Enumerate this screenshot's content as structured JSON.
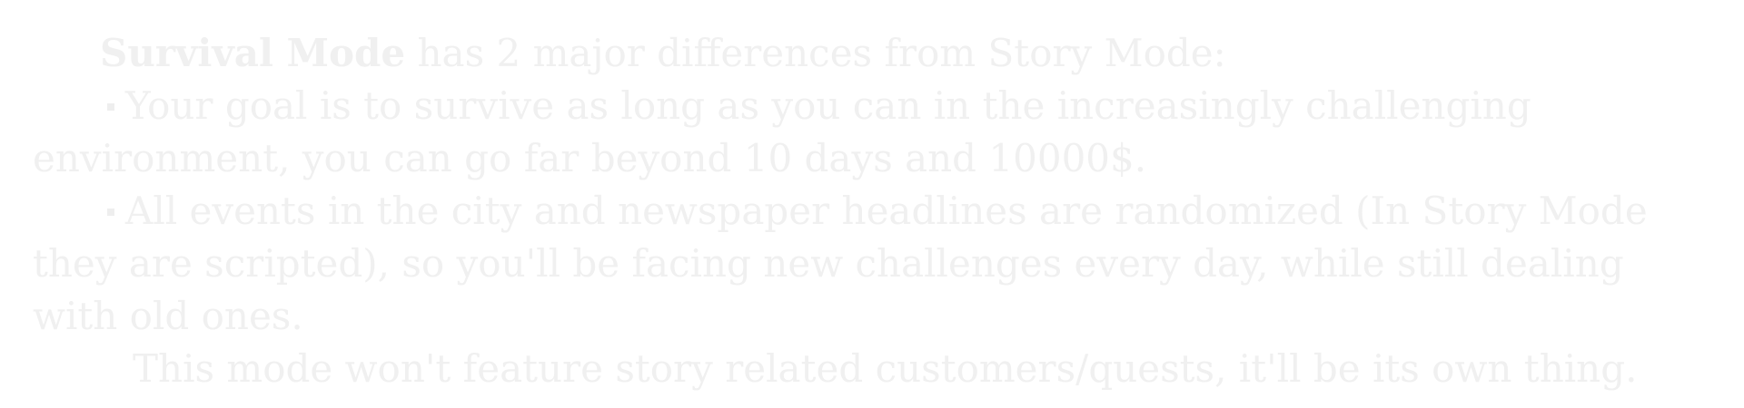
{
  "intro": {
    "mode_name": "Survival Mode",
    "text": " has 2 major differences from Story Mode:"
  },
  "bullets": [
    {
      "text": "Your goal is to survive as long as you can in the increasingly challenging environment, you can go far beyond 10 days and 10000$."
    },
    {
      "text": "All events in the city and newspaper headlines are randomized (In Story Mode they are scripted), so you'll be facing new challenges every day, while still dealing with old ones."
    }
  ],
  "footer_text": "This mode won't feature story related customers/quests, it'll be its own thing.",
  "colors": {
    "background": "#ffffff",
    "text": "#f0f0f0"
  }
}
